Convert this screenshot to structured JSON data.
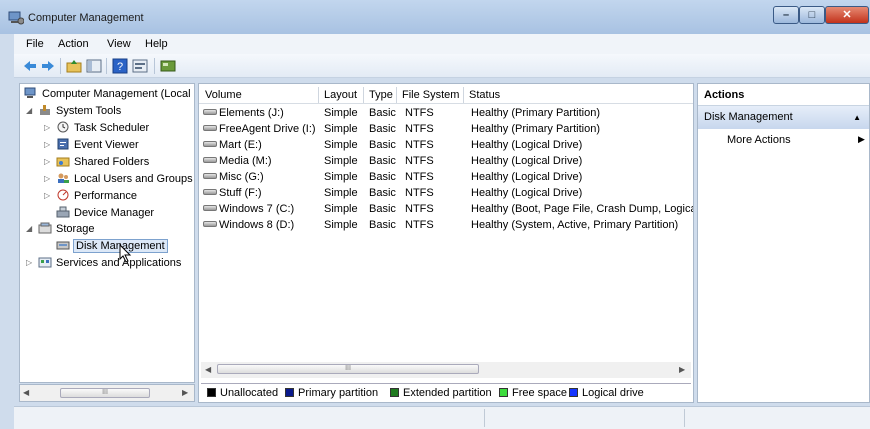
{
  "window": {
    "title": "Computer Management"
  },
  "menu": {
    "items": [
      "File",
      "Action",
      "View",
      "Help"
    ]
  },
  "toolbar": {
    "icons": [
      "back-arrow-icon",
      "forward-arrow-icon",
      "up-folder-icon",
      "show-hide-tree-icon",
      "help-icon",
      "properties-icon",
      "console-icon"
    ]
  },
  "tree": {
    "root": "Computer Management (Local",
    "system_tools": "System Tools",
    "task_scheduler": "Task Scheduler",
    "event_viewer": "Event Viewer",
    "shared_folders": "Shared Folders",
    "local_users": "Local Users and Groups",
    "performance": "Performance",
    "device_manager": "Device Manager",
    "storage": "Storage",
    "disk_management": "Disk Management",
    "services": "Services and Applications",
    "scroll_thumb": "III"
  },
  "table": {
    "headers": [
      "Volume",
      "Layout",
      "Type",
      "File System",
      "Status"
    ],
    "rows": [
      {
        "volume": "Elements (J:)",
        "layout": "Simple",
        "type": "Basic",
        "fs": "NTFS",
        "status": "Healthy (Primary Partition)"
      },
      {
        "volume": "FreeAgent Drive (I:)",
        "layout": "Simple",
        "type": "Basic",
        "fs": "NTFS",
        "status": "Healthy (Primary Partition)"
      },
      {
        "volume": "Mart (E:)",
        "layout": "Simple",
        "type": "Basic",
        "fs": "NTFS",
        "status": "Healthy (Logical Drive)"
      },
      {
        "volume": "Media (M:)",
        "layout": "Simple",
        "type": "Basic",
        "fs": "NTFS",
        "status": "Healthy (Logical Drive)"
      },
      {
        "volume": "Misc (G:)",
        "layout": "Simple",
        "type": "Basic",
        "fs": "NTFS",
        "status": "Healthy (Logical Drive)"
      },
      {
        "volume": "Stuff (F:)",
        "layout": "Simple",
        "type": "Basic",
        "fs": "NTFS",
        "status": "Healthy (Logical Drive)"
      },
      {
        "volume": "Windows 7 (C:)",
        "layout": "Simple",
        "type": "Basic",
        "fs": "NTFS",
        "status": "Healthy (Boot, Page File, Crash Dump, Logica"
      },
      {
        "volume": "Windows 8 (D:)",
        "layout": "Simple",
        "type": "Basic",
        "fs": "NTFS",
        "status": "Healthy (System, Active, Primary Partition)"
      }
    ],
    "scroll_thumb": "III"
  },
  "legend": [
    {
      "label": "Unallocated",
      "color": "#000000"
    },
    {
      "label": "Primary partition",
      "color": "#0a1a8c"
    },
    {
      "label": "Extended partition",
      "color": "#1f7a1f"
    },
    {
      "label": "Free space",
      "color": "#3ddc3d"
    },
    {
      "label": "Logical drive",
      "color": "#1535ff"
    }
  ],
  "actions": {
    "header": "Actions",
    "section": "Disk Management",
    "more": "More Actions"
  },
  "colors": {
    "accent": "#c7d7ed",
    "title_bar": "#a8c2e2",
    "close_button": "#c2321b"
  }
}
